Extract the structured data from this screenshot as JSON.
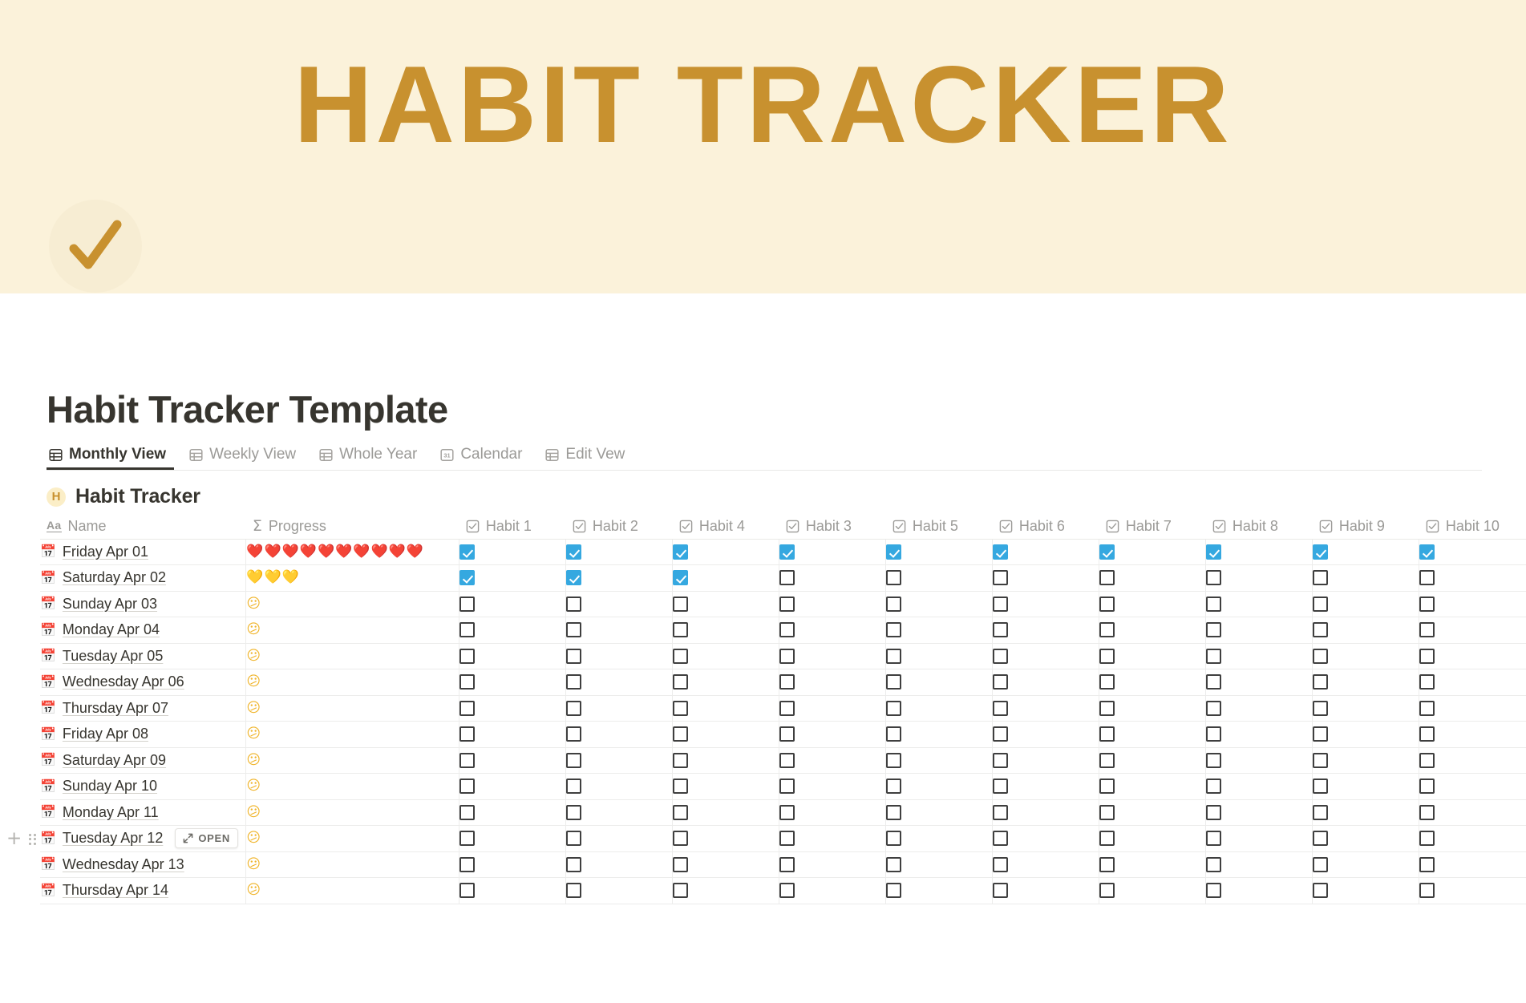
{
  "cover": {
    "title": "HABIT TRACKER",
    "background_color": "#fbf2da",
    "title_color": "#c8912f"
  },
  "page": {
    "icon": "checkmark-icon",
    "icon_color": "#c8912f",
    "title": "Habit Tracker Template"
  },
  "view_tabs": [
    {
      "label": "Monthly View",
      "icon": "table-grid-icon",
      "active": true
    },
    {
      "label": "Weekly View",
      "icon": "table-grid-icon",
      "active": false
    },
    {
      "label": "Whole Year",
      "icon": "table-grid-icon",
      "active": false
    },
    {
      "label": "Calendar",
      "icon": "calendar-31-icon",
      "active": false
    },
    {
      "label": "Edit Vew",
      "icon": "table-grid-icon",
      "active": false
    }
  ],
  "database": {
    "icon_letter": "H",
    "title": "Habit Tracker",
    "columns": [
      {
        "label": "Name",
        "icon": "aa-text-icon",
        "type": "title"
      },
      {
        "label": "Progress",
        "icon": "sigma-formula-icon",
        "type": "formula"
      },
      {
        "label": "Habit 1",
        "icon": "checkbox-icon",
        "type": "checkbox"
      },
      {
        "label": "Habit 2",
        "icon": "checkbox-icon",
        "type": "checkbox"
      },
      {
        "label": "Habit 4",
        "icon": "checkbox-icon",
        "type": "checkbox"
      },
      {
        "label": "Habit 3",
        "icon": "checkbox-icon",
        "type": "checkbox"
      },
      {
        "label": "Habit 5",
        "icon": "checkbox-icon",
        "type": "checkbox"
      },
      {
        "label": "Habit 6",
        "icon": "checkbox-icon",
        "type": "checkbox"
      },
      {
        "label": "Habit 7",
        "icon": "checkbox-icon",
        "type": "checkbox"
      },
      {
        "label": "Habit 8",
        "icon": "checkbox-icon",
        "type": "checkbox"
      },
      {
        "label": "Habit 9",
        "icon": "checkbox-icon",
        "type": "checkbox"
      },
      {
        "label": "Habit 10",
        "icon": "checkbox-icon",
        "type": "checkbox"
      }
    ],
    "rows": [
      {
        "name": "Friday Apr 01",
        "icon": "calendar-emoji",
        "progress_emoji": "red-heart",
        "progress_count": 10,
        "checks": [
          true,
          true,
          true,
          true,
          true,
          true,
          true,
          true,
          true,
          true
        ]
      },
      {
        "name": "Saturday Apr 02",
        "icon": "calendar-emoji",
        "progress_emoji": "yellow-heart",
        "progress_count": 3,
        "checks": [
          true,
          true,
          true,
          false,
          false,
          false,
          false,
          false,
          false,
          false
        ]
      },
      {
        "name": "Sunday Apr 03",
        "icon": "calendar-emoji",
        "progress_emoji": "sad-face",
        "progress_count": 1,
        "checks": [
          false,
          false,
          false,
          false,
          false,
          false,
          false,
          false,
          false,
          false
        ]
      },
      {
        "name": "Monday Apr 04",
        "icon": "calendar-emoji",
        "progress_emoji": "sad-face",
        "progress_count": 1,
        "checks": [
          false,
          false,
          false,
          false,
          false,
          false,
          false,
          false,
          false,
          false
        ]
      },
      {
        "name": "Tuesday Apr 05",
        "icon": "calendar-emoji",
        "progress_emoji": "sad-face",
        "progress_count": 1,
        "checks": [
          false,
          false,
          false,
          false,
          false,
          false,
          false,
          false,
          false,
          false
        ]
      },
      {
        "name": "Wednesday Apr 06",
        "icon": "calendar-emoji",
        "progress_emoji": "sad-face",
        "progress_count": 1,
        "checks": [
          false,
          false,
          false,
          false,
          false,
          false,
          false,
          false,
          false,
          false
        ]
      },
      {
        "name": "Thursday Apr 07",
        "icon": "calendar-emoji",
        "progress_emoji": "sad-face",
        "progress_count": 1,
        "checks": [
          false,
          false,
          false,
          false,
          false,
          false,
          false,
          false,
          false,
          false
        ]
      },
      {
        "name": "Friday Apr 08",
        "icon": "calendar-emoji",
        "progress_emoji": "sad-face",
        "progress_count": 1,
        "checks": [
          false,
          false,
          false,
          false,
          false,
          false,
          false,
          false,
          false,
          false
        ]
      },
      {
        "name": "Saturday Apr 09",
        "icon": "calendar-emoji",
        "progress_emoji": "sad-face",
        "progress_count": 1,
        "checks": [
          false,
          false,
          false,
          false,
          false,
          false,
          false,
          false,
          false,
          false
        ]
      },
      {
        "name": "Sunday Apr 10",
        "icon": "calendar-emoji",
        "progress_emoji": "sad-face",
        "progress_count": 1,
        "checks": [
          false,
          false,
          false,
          false,
          false,
          false,
          false,
          false,
          false,
          false
        ]
      },
      {
        "name": "Monday Apr 11",
        "icon": "calendar-emoji",
        "progress_emoji": "sad-face",
        "progress_count": 1,
        "checks": [
          false,
          false,
          false,
          false,
          false,
          false,
          false,
          false,
          false,
          false
        ]
      },
      {
        "name": "Tuesday Apr 12",
        "icon": "calendar-emoji",
        "progress_emoji": "sad-face",
        "progress_count": 1,
        "checks": [
          false,
          false,
          false,
          false,
          false,
          false,
          false,
          false,
          false,
          false
        ],
        "hovered": true
      },
      {
        "name": "Wednesday Apr 13",
        "icon": "calendar-emoji",
        "progress_emoji": "sad-face",
        "progress_count": 1,
        "checks": [
          false,
          false,
          false,
          false,
          false,
          false,
          false,
          false,
          false,
          false
        ]
      },
      {
        "name": "Thursday Apr 14",
        "icon": "calendar-emoji",
        "progress_emoji": "sad-face",
        "progress_count": 1,
        "checks": [
          false,
          false,
          false,
          false,
          false,
          false,
          false,
          false,
          false,
          false
        ]
      }
    ]
  },
  "row_controls": {
    "add_label": "+",
    "open_label": "OPEN"
  },
  "colors": {
    "checkbox_checked": "#35a8e0",
    "accent": "#c8912f",
    "text": "#37352f",
    "muted": "#9b9a97"
  },
  "emoji": {
    "red-heart": "❤️",
    "yellow-heart": "💛",
    "sad-face": "😕",
    "calendar-emoji": "📅"
  }
}
